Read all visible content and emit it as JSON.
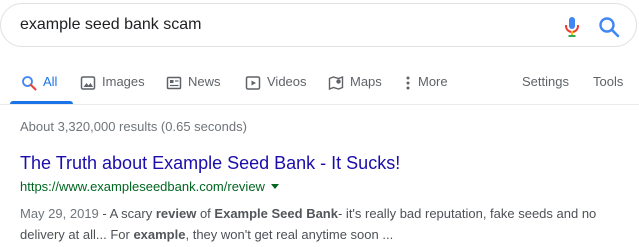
{
  "search": {
    "query": "example seed bank scam",
    "colors": {
      "mic_blue": "#4285f4",
      "mic_red": "#ea4335",
      "mic_yellow": "#fbbc05",
      "mic_green": "#34a853",
      "search_icon": "#4285f4"
    }
  },
  "tabs": [
    {
      "label": "All",
      "icon": "search-icon",
      "active": true
    },
    {
      "label": "Images",
      "icon": "image-icon",
      "active": false
    },
    {
      "label": "News",
      "icon": "news-icon",
      "active": false
    },
    {
      "label": "Videos",
      "icon": "video-icon",
      "active": false
    },
    {
      "label": "Maps",
      "icon": "map-icon",
      "active": false
    },
    {
      "label": "More",
      "icon": "more-vert-icon",
      "active": false
    }
  ],
  "tools": {
    "settings": "Settings",
    "tools": "Tools"
  },
  "stats": "About 3,320,000 results (0.65 seconds)",
  "result": {
    "title": "The Truth about Example Seed Bank - It Sucks!",
    "url": "https://www.exampleseedbank.com/review",
    "date": "May 29, 2019",
    "snippet_parts": [
      " - A scary ",
      "review",
      " of ",
      "Example Seed Bank",
      "- it's really bad reputation, fake seeds and no delivery at all... For ",
      "example",
      ", they won't get real anytime soon ..."
    ]
  }
}
